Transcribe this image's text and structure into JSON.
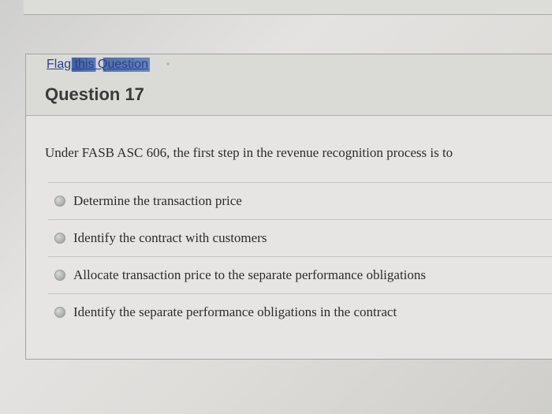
{
  "question": {
    "flag_label": "Flag this Question",
    "title": "Question 17",
    "prompt": "Under FASB ASC 606, the first step in the revenue recognition process is to",
    "options": [
      "Determine the transaction price",
      "Identify the contract with customers",
      "Allocate transaction price to the separate performance obligations",
      "Identify the separate performance obligations in the contract"
    ]
  }
}
